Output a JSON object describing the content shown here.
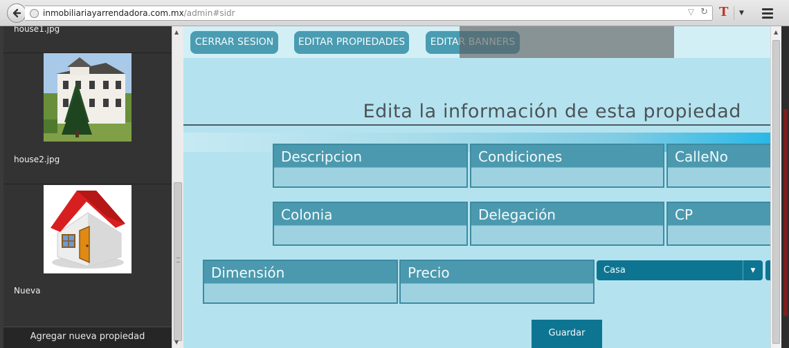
{
  "browser": {
    "url_domain": "inmobiliariayarrendadora.com.mx",
    "url_path": "/admin#sidr",
    "extension_letter": "T"
  },
  "sidebar": {
    "items": [
      {
        "caption": "house1.jpg"
      },
      {
        "caption": "house2.jpg",
        "image": "house-photo"
      },
      {
        "caption": "Nueva",
        "image": "house-clipart"
      }
    ],
    "add_label": "Agregar nueva propiedad"
  },
  "nav": {
    "logout_label": "CERRAR SESION",
    "edit_properties_label": "EDITAR PROPIEDADES",
    "edit_banners_label": "EDITAR BANNERS"
  },
  "form": {
    "heading": "Edita la información de esta propiedad",
    "fields": [
      {
        "label": "Descripcion"
      },
      {
        "label": "Condiciones"
      },
      {
        "label": "CalleNo"
      },
      {
        "label": "Colonia"
      },
      {
        "label": "Delegación"
      },
      {
        "label": "CP"
      },
      {
        "label": "Dimensión"
      },
      {
        "label": "Precio"
      }
    ],
    "type_select_value": "Casa",
    "save_label": "Guardar"
  },
  "colors": {
    "sidebar_bg": "#333333",
    "page_bg": "#b4e3ef",
    "field_header": "#4b99ae",
    "field_input": "#9fd2e1",
    "primary_button": "#0d7592",
    "nav_button": "#4a9cb2"
  }
}
